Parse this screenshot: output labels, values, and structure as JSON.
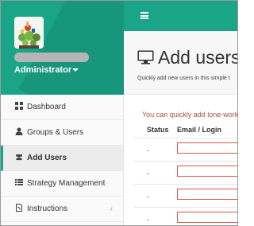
{
  "sidebar": {
    "user": {
      "role": "Administrator"
    },
    "menu": [
      {
        "label": "Dashboard",
        "icon": "dashboard-icon"
      },
      {
        "label": "Groups & Users",
        "icon": "user-icon"
      },
      {
        "label": "Add Users",
        "icon": "users-icon"
      },
      {
        "label": "Strategy Management",
        "icon": "list-icon"
      },
      {
        "label": "Instructions",
        "icon": "document-icon"
      }
    ]
  },
  "topbar": {
    "menu_icon": "hamburger-icon"
  },
  "page": {
    "title": "Add users",
    "subtitle": "Quickly add new users in this simple t",
    "hint": "You can quickly add lone-work",
    "table": {
      "headers": [
        "Status",
        "Email / Login"
      ],
      "rows": [
        {
          "status": "-",
          "email": ""
        },
        {
          "status": "-",
          "email": ""
        },
        {
          "status": "-",
          "email": ""
        },
        {
          "status": "-",
          "email": ""
        }
      ]
    }
  },
  "colors": {
    "brand": "#1aa589",
    "input_error_border": "#d9534f"
  }
}
